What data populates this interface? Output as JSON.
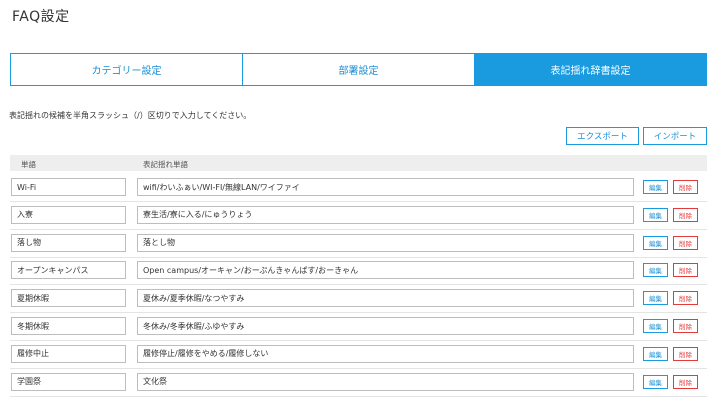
{
  "page": {
    "title": "FAQ設定"
  },
  "tabs": [
    {
      "label": "カテゴリー設定",
      "active": false
    },
    {
      "label": "部署設定",
      "active": false
    },
    {
      "label": "表記揺れ辞書設定",
      "active": true
    }
  ],
  "instruction": "表記揺れの候補を半角スラッシュ（/）区切りで入力してください。",
  "actions": {
    "export_label": "エクスポート",
    "import_label": "インポート"
  },
  "table": {
    "headers": {
      "word": "単語",
      "variants": "表記揺れ単語"
    },
    "edit_label": "編集",
    "delete_label": "削除",
    "rows": [
      {
        "word": "Wi-Fi",
        "variants": "wifi/わいふぁい/WI-FI/無線LAN/ワイファイ"
      },
      {
        "word": "入寮",
        "variants": "寮生活/寮に入る/にゅうりょう"
      },
      {
        "word": "落し物",
        "variants": "落とし物"
      },
      {
        "word": "オープンキャンパス",
        "variants": "Open campus/オーキャン/おーぷんきゃんぱす/おーきゃん"
      },
      {
        "word": "夏期休暇",
        "variants": "夏休み/夏季休暇/なつやすみ"
      },
      {
        "word": "冬期休暇",
        "variants": "冬休み/冬季休暇/ふゆやすみ"
      },
      {
        "word": "履修中止",
        "variants": "履修停止/履修をやめる/履修しない"
      },
      {
        "word": "学園祭",
        "variants": "文化祭"
      }
    ]
  },
  "colors": {
    "accent": "#1a9be0",
    "danger": "#e23b3b",
    "header_bg": "#eeeeee"
  }
}
